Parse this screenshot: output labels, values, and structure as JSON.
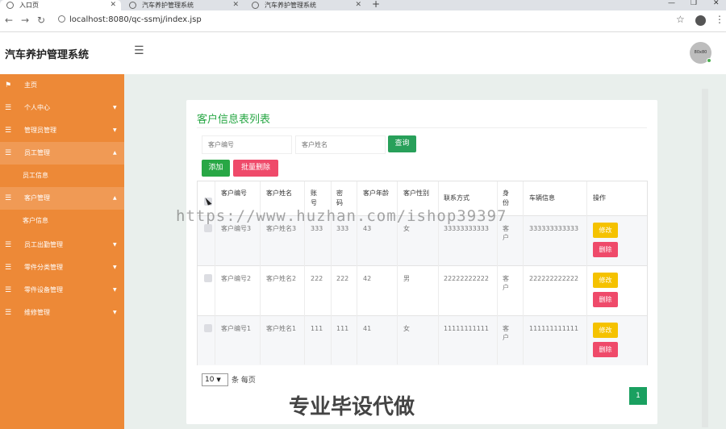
{
  "browser": {
    "tabs": [
      {
        "label": "入口页"
      },
      {
        "label": "汽车养护管理系统"
      },
      {
        "label": "汽车养护管理系统"
      }
    ],
    "url": "localhost:8080/qc-ssmj/index.jsp"
  },
  "header": {
    "brand": "汽车养护管理系统",
    "avatar_text": "80x80"
  },
  "sidebar": {
    "items": [
      {
        "label": "主页"
      },
      {
        "label": "个人中心"
      },
      {
        "label": "管理员管理"
      },
      {
        "label": "员工管理"
      },
      {
        "label": "员工信息"
      },
      {
        "label": "客户管理"
      },
      {
        "label": "客户信息"
      },
      {
        "label": "员工出勤管理"
      },
      {
        "label": "零件分类管理"
      },
      {
        "label": "零件设备管理"
      },
      {
        "label": "维修管理"
      }
    ]
  },
  "main": {
    "title": "客户信息表列表",
    "search": {
      "customer_no_placeholder": "客户编号",
      "customer_name_placeholder": "客户姓名",
      "query_label": "查询"
    },
    "actions": {
      "add": "添加",
      "batch_delete": "批量删除"
    },
    "table": {
      "headers": [
        "客户编号",
        "客户姓名",
        "账号",
        "密码",
        "客户年龄",
        "客户性别",
        "联系方式",
        "身份",
        "车辆信息",
        "操作"
      ],
      "rows": [
        {
          "no": "客户编号3",
          "name": "客户姓名3",
          "account": "333",
          "password": "333",
          "age": "43",
          "gender": "女",
          "phone": "33333333333",
          "role": "客户",
          "vehicle": "333333333333",
          "edit": "修改",
          "delete": "删除"
        },
        {
          "no": "客户编号2",
          "name": "客户姓名2",
          "account": "222",
          "password": "222",
          "age": "42",
          "gender": "男",
          "phone": "22222222222",
          "role": "客户",
          "vehicle": "222222222222",
          "edit": "修改",
          "delete": "删除"
        },
        {
          "no": "客户编号1",
          "name": "客户姓名1",
          "account": "111",
          "password": "111",
          "age": "41",
          "gender": "女",
          "phone": "11111111111",
          "role": "客户",
          "vehicle": "111111111111",
          "edit": "修改",
          "delete": "删除"
        }
      ]
    },
    "pager": {
      "page_size": "10",
      "suffix": "条 每页",
      "current_page": "1"
    }
  },
  "watermarks": {
    "url": "https://www.huzhan.com/ishop39397",
    "slogan": "专业毕设代做"
  },
  "colors": {
    "sidebar": "#ed8937",
    "accent_green": "#28a745",
    "danger": "#ef4a6a",
    "warning": "#f5c200"
  }
}
